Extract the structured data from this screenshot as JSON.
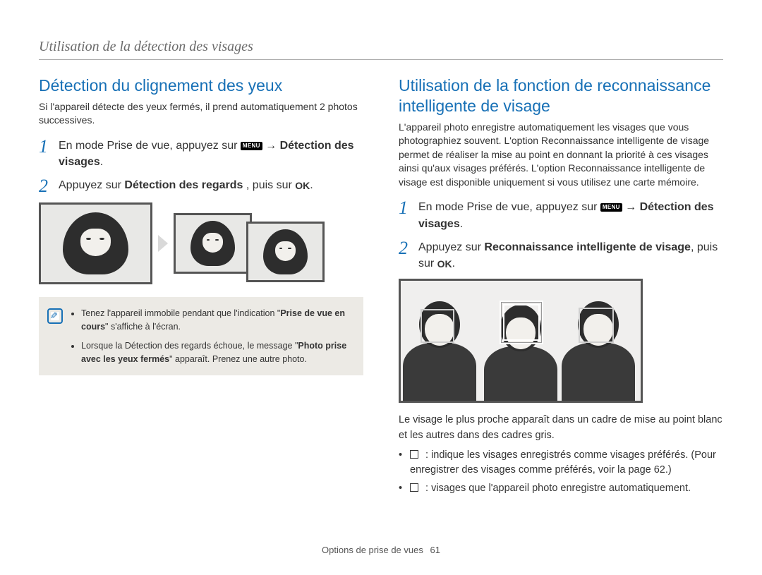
{
  "header": {
    "breadcrumb": "Utilisation de la détection des visages"
  },
  "left": {
    "title": "Détection du clignement des yeux",
    "intro": "Si l'appareil détecte des yeux fermés, il prend automatiquement 2 photos successives.",
    "step1_a": "En mode Prise de vue, appuyez sur ",
    "step1_menu": "MENU",
    "step1_b": " → ",
    "step1_bold": "Détection des visages",
    "step1_c": ".",
    "step2_a": "Appuyez sur ",
    "step2_bold": "Détection des regards",
    "step2_b": ", puis sur ",
    "step2_ok": "OK",
    "step2_c": ".",
    "note1_a": "Tenez l'appareil immobile pendant que l'indication \"",
    "note1_bold": "Prise de vue en cours",
    "note1_b": "\" s'affiche à l'écran.",
    "note2_a": "Lorsque la Détection des regards échoue, le message \"",
    "note2_bold": "Photo prise avec les yeux fermés",
    "note2_b": "\" apparaît. Prenez une autre photo."
  },
  "right": {
    "title": "Utilisation de la fonction de reconnaissance intelligente de visage",
    "intro": "L'appareil photo enregistre automatiquement les visages que vous photographiez souvent. L'option Reconnaissance intelligente de visage permet de réaliser la mise au point en donnant la priorité à ces visages ainsi qu'aux visages préférés. L'option Reconnaissance intelligente de visage est disponible uniquement si vous utilisez une carte mémoire.",
    "step1_a": "En mode Prise de vue, appuyez sur ",
    "step1_menu": "MENU",
    "step1_b": " → ",
    "step1_bold": "Détection des visages",
    "step1_c": ".",
    "step2_a": "Appuyez sur ",
    "step2_bold": "Reconnaissance intelligente de visage",
    "step2_b": ", puis sur ",
    "step2_ok": "OK",
    "step2_c": ".",
    "under_photo": "Le visage le plus proche apparaît dans un cadre de mise au point blanc et les autres dans des cadres gris.",
    "b1": " : indique les visages enregistrés comme visages préférés. (Pour enregistrer des visages comme préférés, voir la page 62.)",
    "b2": " : visages que l'appareil photo enregistre automatiquement."
  },
  "footer": {
    "label": "Options de prise de vues",
    "page": "61"
  }
}
